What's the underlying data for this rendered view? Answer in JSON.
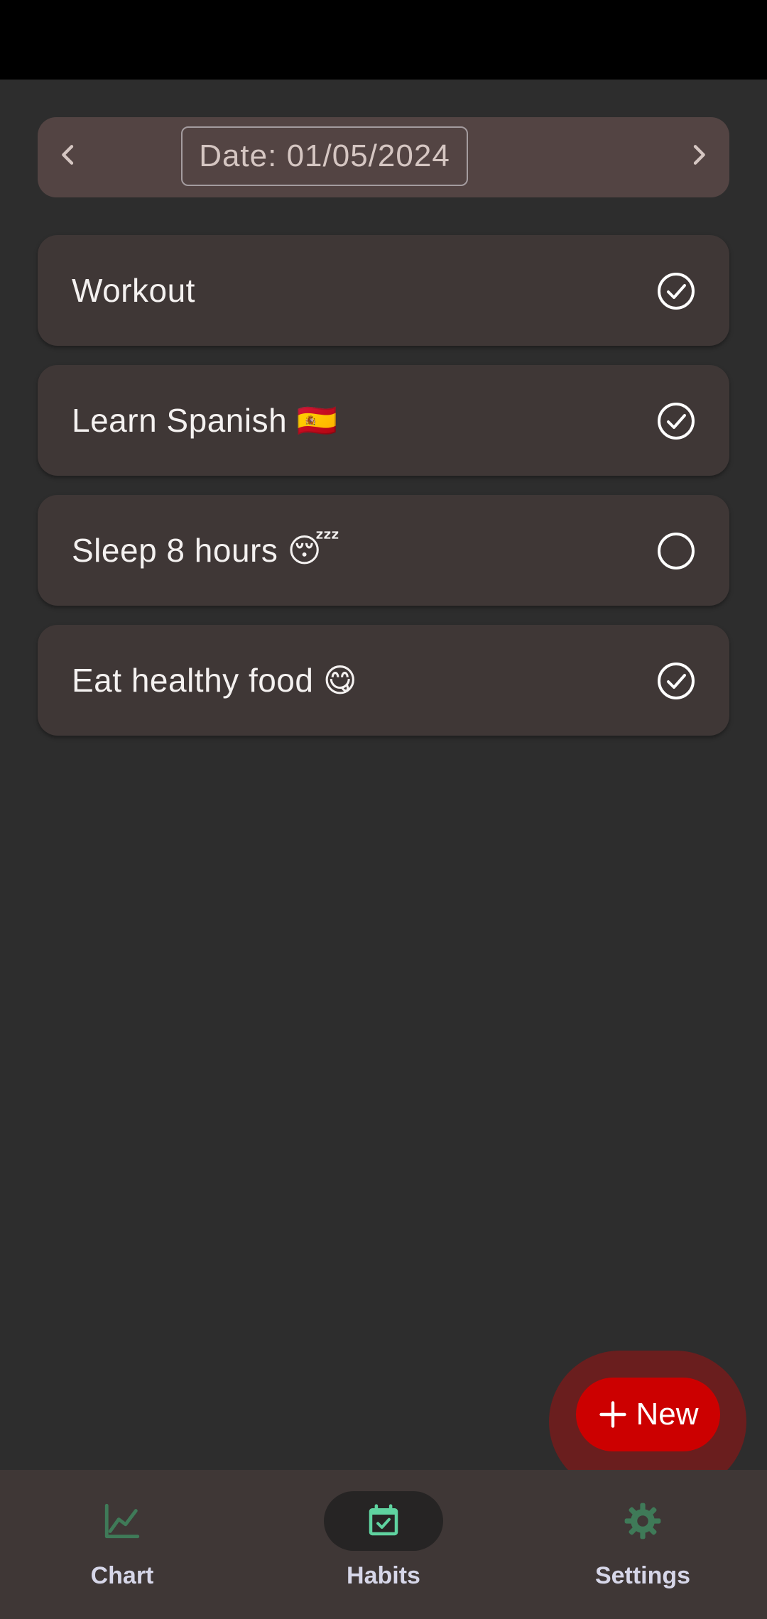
{
  "date_bar": {
    "date_text": "Date: 01/05/2024"
  },
  "habits": [
    {
      "name": "Workout",
      "done": true
    },
    {
      "name": "Learn Spanish 🇪🇸",
      "done": true
    },
    {
      "name": "Sleep 8 hours 😴",
      "done": false
    },
    {
      "name": "Eat healthy food 😋",
      "done": true
    }
  ],
  "fab": {
    "label": "New",
    "icon": "plus-icon"
  },
  "bottom_nav": {
    "items": [
      {
        "label": "Chart",
        "icon": "line-chart-icon"
      },
      {
        "label": "Habits",
        "icon": "calendar-check-icon",
        "active": true
      },
      {
        "label": "Settings",
        "icon": "gear-icon"
      }
    ]
  },
  "colors": {
    "background": "#2d2d2d",
    "card": "#3f3736",
    "date_bar": "#534443",
    "fab": "#cc0000",
    "fab_halo": "#6a1e1e",
    "nav_icon_green": "#3f7a58",
    "nav_icon_active": "#5fd3a0"
  }
}
